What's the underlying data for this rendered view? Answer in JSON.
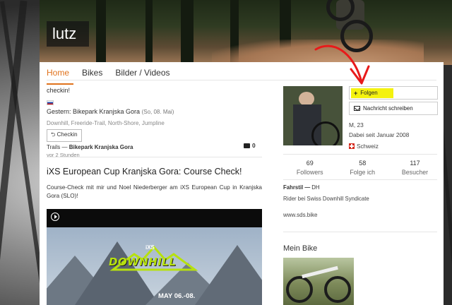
{
  "header": {
    "username": "lutz"
  },
  "nav": {
    "tabs": [
      {
        "label": "Home",
        "active": true
      },
      {
        "label": "Bikes"
      },
      {
        "label": "Bilder / Videos"
      }
    ]
  },
  "feed": {
    "checkin": {
      "title": "checkin!",
      "yesterday_label": "Gestern: Bikepark Kranjska Gora",
      "date": "(So, 08. Mai)",
      "tags": "Downhill, Freeride-Trail, North-Shore, Jumpline",
      "checkin_button": "Checkin",
      "trails_prefix": "Trails —",
      "trails_name": "Bikepark Kranjska Gora",
      "ago": "vor 2 Stunden",
      "comment_count": "0"
    },
    "post": {
      "title": "iXS European Cup Kranjska Gora: Course Check!",
      "body": "Course-Check mit mir und Noel Niederberger am iXS European Cup in Kranjska Gora (SLO)!",
      "video": {
        "brand": "iXS",
        "title": "DOWNHILL",
        "dates": "MAY 06.-08."
      }
    }
  },
  "profile": {
    "follow_button": "Folgen",
    "message_button": "Nachricht schreiben",
    "gender_age": "M, 23",
    "member_since": "Dabei seit Januar 2008",
    "country": "Schweiz",
    "stats": [
      {
        "value": "69",
        "label": "Followers"
      },
      {
        "value": "58",
        "label": "Folge ich"
      },
      {
        "value": "117",
        "label": "Besucher"
      }
    ],
    "fahrstil_label": "Fahrstil —",
    "fahrstil_value": "DH",
    "rider_of": "Rider bei Swiss Downhill Syndicate",
    "website": "www.sds.bike",
    "bike_title": "Mein Bike"
  },
  "colors": {
    "accent": "#e0721c",
    "highlight": "#f4f20f",
    "annotation": "#e81a1a"
  }
}
